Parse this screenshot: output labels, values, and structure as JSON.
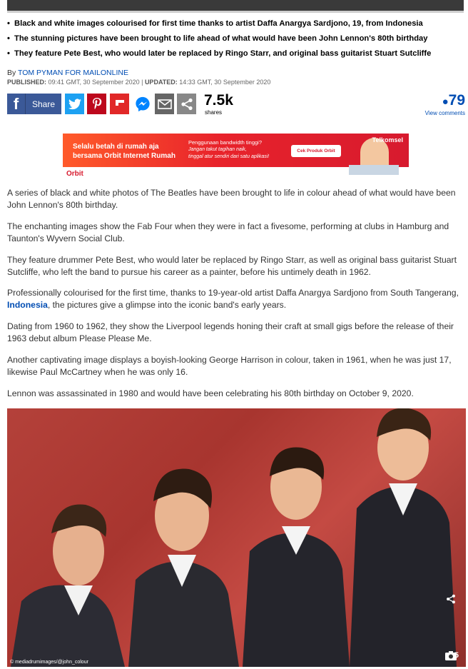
{
  "bullets": [
    "Black and white images colourised for first time thanks to artist Daffa Anargya Sardjono, 19, from Indonesia",
    "The stunning pictures have been brought to life ahead of what would have been John Lennon's 80th birthday",
    "They feature Pete Best, who would later be replaced by Ringo Starr, and original bass guitarist Stuart Sutcliffe"
  ],
  "byline": {
    "prefix": "By ",
    "author": "TOM PYMAN FOR MAILONLINE"
  },
  "published": {
    "label": "PUBLISHED:",
    "value": " 09:41 GMT, 30 September 2020 | ",
    "updated_label": "UPDATED:",
    "updated_value": " 14:33 GMT, 30 September 2020"
  },
  "share": {
    "facebook_icon": "f",
    "facebook_label": "Share",
    "count": "7.5k",
    "count_label": "shares"
  },
  "icons": {
    "twitter": "twitter-icon",
    "pinterest": "pinterest-icon",
    "flipboard": "flipboard-icon",
    "messenger": "messenger-icon",
    "email": "email-icon",
    "share": "share-icon"
  },
  "comments": {
    "count": "79",
    "label": "View comments"
  },
  "ad": {
    "headline1": "Selalu betah di rumah aja",
    "headline2": "bersama Orbit Internet Rumah",
    "line1": "Penggunaan bandwidth tinggi?",
    "line2": "Jangan takut tagihan naik,",
    "line3": "tinggal atur sendiri dari satu aplikasi!",
    "cta": "Cek Produk Orbit",
    "brand": "Telkomsel",
    "logo": "Orbit"
  },
  "paragraphs": [
    {
      "text": "A series of black and white photos of The Beatles have been brought to life in colour ahead of what would have been John Lennon's 80th birthday."
    },
    {
      "text": "The enchanting images show the Fab Four when they were in fact a fivesome, performing at clubs in Hamburg and Taunton's Wyvern Social Club."
    },
    {
      "text": "They feature drummer Pete Best, who would later be replaced by Ringo Starr, as well as original bass guitarist Stuart Sutcliffe, who left the band to pursue his career as a painter, before his untimely death in 1962."
    },
    {
      "before": "Professionally colourised for the first time, thanks to 19-year-old artist Daffa Anargya Sardjono from South Tangerang, ",
      "link": "Indonesia",
      "after": ", the pictures give a glimpse into the iconic band's early years."
    },
    {
      "text": "Dating from 1960 to 1962, they show the Liverpool legends honing their craft at small gigs before the release of their 1963 debut album Please Please Me."
    },
    {
      "text": "Another captivating image displays a boyish-looking George Harrison in colour, taken in 1961, when he was just 17, likewise Paul McCartney when he was only 16."
    },
    {
      "text": "Lennon was assassinated in 1980 and would have been celebrating his 80th birthday on October 9, 2020."
    }
  ],
  "photo": {
    "credit": "© mediadrumimages/@john_colour",
    "gallery_count": "+15"
  },
  "colors": {
    "link": "#004db3",
    "facebook": "#3b5998",
    "twitter": "#1da1f2",
    "pinterest": "#bd081c",
    "flipboard": "#e12828"
  }
}
